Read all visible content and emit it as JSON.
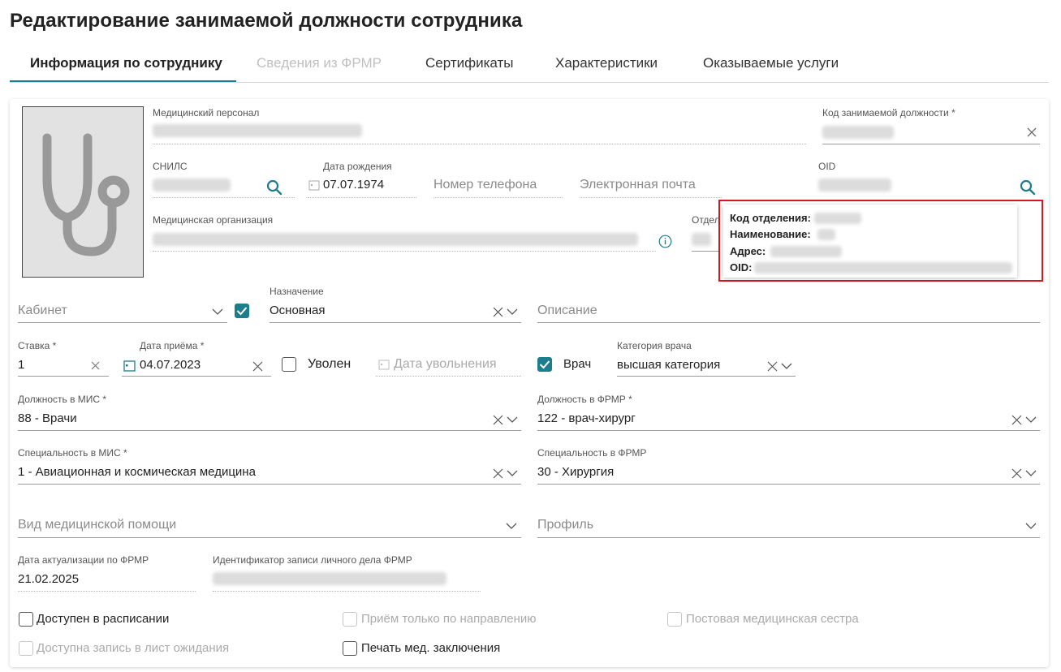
{
  "page": {
    "title": "Редактирование занимаемой должности сотрудника"
  },
  "tabs": [
    {
      "label": "Информация по сотруднику",
      "state": "active"
    },
    {
      "label": "Сведения из ФРМР",
      "state": "disabled"
    },
    {
      "label": "Сертификаты",
      "state": "normal"
    },
    {
      "label": "Характеристики",
      "state": "normal"
    },
    {
      "label": "Оказываемые услуги",
      "state": "normal"
    }
  ],
  "colors": {
    "accent": "#1e7d8c",
    "highlight": "#d6181e",
    "photo_bg": "#e2e2e2"
  },
  "icons": {
    "photo": "stethoscope-icon",
    "search": "search-icon",
    "clear": "close-icon",
    "dropdown": "chevron-down-icon",
    "info": "info-icon",
    "calendar": "calendar-icon"
  },
  "employee": {
    "med_personnel_label": "Медицинский персонал",
    "position_code_label": "Код занимаемой должности *",
    "snils_label": "СНИЛС",
    "birth_date_label": "Дата рождения",
    "birth_date": "07.07.1974",
    "phone_placeholder": "Номер телефона",
    "email_placeholder": "Электронная почта",
    "oid_label": "OID",
    "med_org_label": "Медицинская организация",
    "department_label": "Отделе"
  },
  "popup": {
    "dept_code_label": "Код отделения:",
    "name_label": "Наименование:",
    "address_label": "Адрес:",
    "oid_label": "OID:"
  },
  "form": {
    "cabinet_placeholder": "Кабинет",
    "purpose_label": "Назначение",
    "purpose_value": "Основная",
    "purpose_checked": true,
    "description_placeholder": "Описание",
    "rate_label": "Ставка *",
    "rate_value": "1",
    "hire_date_label": "Дата приёма *",
    "hire_date_value": "04.07.2023",
    "dismissed_label": "Уволен",
    "dismissed_checked": false,
    "dismissal_date_placeholder": "Дата увольнения",
    "doctor_label": "Врач",
    "doctor_checked": true,
    "doctor_category_label": "Категория врача",
    "doctor_category_value": "высшая категория",
    "mis_position_label": "Должность в МИС *",
    "mis_position_value": "88 - Врачи",
    "frmr_position_label": "Должность в ФРМР *",
    "frmr_position_value": "122 - врач-хирург",
    "mis_specialty_label": "Специальность в МИС *",
    "mis_specialty_value": "1 - Авиационная и космическая медицина",
    "frmr_specialty_label": "Специальность в ФРМР",
    "frmr_specialty_value": "30 - Хирургия",
    "care_type_placeholder": "Вид медицинской помощи",
    "profile_placeholder": "Профиль",
    "frmr_update_date_label": "Дата актуализации по ФРМР",
    "frmr_update_date_value": "21.02.2025",
    "frmr_record_id_label": "Идентификатор записи личного дела ФРМР"
  },
  "checkboxes": [
    {
      "label": "Доступен в расписании",
      "checked": false,
      "disabled": false
    },
    {
      "label": "Приём только по направлению",
      "checked": false,
      "disabled": true
    },
    {
      "label": "Постовая медицинская сестра",
      "checked": false,
      "disabled": true
    },
    {
      "label": "Доступна запись в лист ожидания",
      "checked": false,
      "disabled": true
    },
    {
      "label": "Печать мед. заключения",
      "checked": false,
      "disabled": false
    }
  ]
}
